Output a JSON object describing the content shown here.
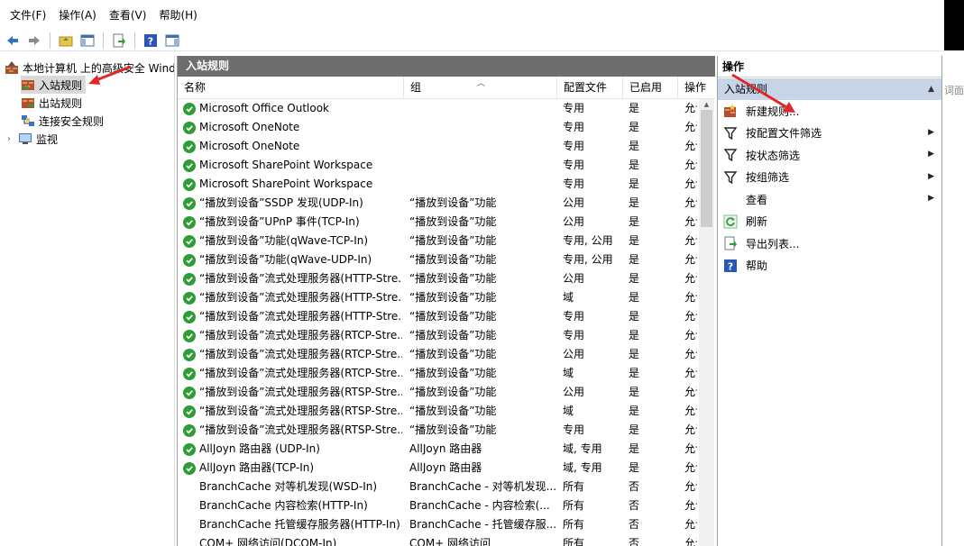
{
  "menu": [
    "文件(F)",
    "操作(A)",
    "查看(V)",
    "帮助(H)"
  ],
  "tree": {
    "root": "本地计算机 上的高级安全 Windows",
    "items": [
      "入站规则",
      "出站规则",
      "连接安全规则",
      "监视"
    ]
  },
  "middle": {
    "title": "入站规则",
    "columns": [
      "名称",
      "组",
      "配置文件",
      "已启用",
      "操作"
    ]
  },
  "rules": [
    {
      "name": "Microsoft Office Outlook",
      "group": "",
      "profile": "专用",
      "enabled": "是",
      "action": "允许",
      "checked": true
    },
    {
      "name": "Microsoft OneNote",
      "group": "",
      "profile": "专用",
      "enabled": "是",
      "action": "允许",
      "checked": true
    },
    {
      "name": "Microsoft OneNote",
      "group": "",
      "profile": "专用",
      "enabled": "是",
      "action": "允许",
      "checked": true
    },
    {
      "name": "Microsoft SharePoint Workspace",
      "group": "",
      "profile": "专用",
      "enabled": "是",
      "action": "允许",
      "checked": true
    },
    {
      "name": "Microsoft SharePoint Workspace",
      "group": "",
      "profile": "专用",
      "enabled": "是",
      "action": "允许",
      "checked": true
    },
    {
      "name": "“播放到设备”SSDP 发现(UDP-In)",
      "group": "“播放到设备”功能",
      "profile": "公用",
      "enabled": "是",
      "action": "允许",
      "checked": true
    },
    {
      "name": "“播放到设备”UPnP 事件(TCP-In)",
      "group": "“播放到设备”功能",
      "profile": "公用",
      "enabled": "是",
      "action": "允许",
      "checked": true
    },
    {
      "name": "“播放到设备”功能(qWave-TCP-In)",
      "group": "“播放到设备”功能",
      "profile": "专用, 公用",
      "enabled": "是",
      "action": "允许",
      "checked": true
    },
    {
      "name": "“播放到设备”功能(qWave-UDP-In)",
      "group": "“播放到设备”功能",
      "profile": "专用, 公用",
      "enabled": "是",
      "action": "允许",
      "checked": true
    },
    {
      "name": "“播放到设备”流式处理服务器(HTTP-Stre...",
      "group": "“播放到设备”功能",
      "profile": "公用",
      "enabled": "是",
      "action": "允许",
      "checked": true
    },
    {
      "name": "“播放到设备”流式处理服务器(HTTP-Stre...",
      "group": "“播放到设备”功能",
      "profile": "域",
      "enabled": "是",
      "action": "允许",
      "checked": true
    },
    {
      "name": "“播放到设备”流式处理服务器(HTTP-Stre...",
      "group": "“播放到设备”功能",
      "profile": "专用",
      "enabled": "是",
      "action": "允许",
      "checked": true
    },
    {
      "name": "“播放到设备”流式处理服务器(RTCP-Stre...",
      "group": "“播放到设备”功能",
      "profile": "专用",
      "enabled": "是",
      "action": "允许",
      "checked": true
    },
    {
      "name": "“播放到设备”流式处理服务器(RTCP-Stre...",
      "group": "“播放到设备”功能",
      "profile": "公用",
      "enabled": "是",
      "action": "允许",
      "checked": true
    },
    {
      "name": "“播放到设备”流式处理服务器(RTCP-Stre...",
      "group": "“播放到设备”功能",
      "profile": "域",
      "enabled": "是",
      "action": "允许",
      "checked": true
    },
    {
      "name": "“播放到设备”流式处理服务器(RTSP-Stre...",
      "group": "“播放到设备”功能",
      "profile": "公用",
      "enabled": "是",
      "action": "允许",
      "checked": true
    },
    {
      "name": "“播放到设备”流式处理服务器(RTSP-Stre...",
      "group": "“播放到设备”功能",
      "profile": "域",
      "enabled": "是",
      "action": "允许",
      "checked": true
    },
    {
      "name": "“播放到设备”流式处理服务器(RTSP-Stre...",
      "group": "“播放到设备”功能",
      "profile": "专用",
      "enabled": "是",
      "action": "允许",
      "checked": true
    },
    {
      "name": "AllJoyn 路由器 (UDP-In)",
      "group": "AllJoyn 路由器",
      "profile": "域, 专用",
      "enabled": "是",
      "action": "允许",
      "checked": true
    },
    {
      "name": "AllJoyn 路由器(TCP-In)",
      "group": "AllJoyn 路由器",
      "profile": "域, 专用",
      "enabled": "是",
      "action": "允许",
      "checked": true
    },
    {
      "name": "BranchCache 对等机发现(WSD-In)",
      "group": "BranchCache - 对等机发现...",
      "profile": "所有",
      "enabled": "否",
      "action": "允许",
      "checked": false
    },
    {
      "name": "BranchCache 内容检索(HTTP-In)",
      "group": "BranchCache - 内容检索(...",
      "profile": "所有",
      "enabled": "否",
      "action": "允许",
      "checked": false
    },
    {
      "name": "BranchCache 托管缓存服务器(HTTP-In)",
      "group": "BranchCache - 托管缓存服...",
      "profile": "所有",
      "enabled": "否",
      "action": "允许",
      "checked": false
    },
    {
      "name": "COM+ 网络访问(DCOM-In)",
      "group": "COM+ 网络访问",
      "profile": "所有",
      "enabled": "否",
      "action": "允许",
      "checked": false
    }
  ],
  "actions": {
    "title": "操作",
    "section": "入站规则",
    "items": [
      {
        "label": "新建规则...",
        "icon": "new-rule-icon",
        "submenu": false
      },
      {
        "label": "按配置文件筛选",
        "icon": "filter-icon",
        "submenu": true
      },
      {
        "label": "按状态筛选",
        "icon": "filter-icon",
        "submenu": true
      },
      {
        "label": "按组筛选",
        "icon": "filter-icon",
        "submenu": true
      },
      {
        "label": "查看",
        "icon": "",
        "submenu": true
      },
      {
        "label": "刷新",
        "icon": "refresh-icon",
        "submenu": false
      },
      {
        "label": "导出列表...",
        "icon": "export-icon",
        "submenu": false
      },
      {
        "label": "帮助",
        "icon": "help-icon",
        "submenu": false
      }
    ]
  },
  "offscreen_label": "词面板",
  "colors": {
    "accent_header": "#6e6e6e",
    "section_bg": "#c8d4e8",
    "check_green": "#2e9d38",
    "annotation_red": "#e0282b"
  }
}
